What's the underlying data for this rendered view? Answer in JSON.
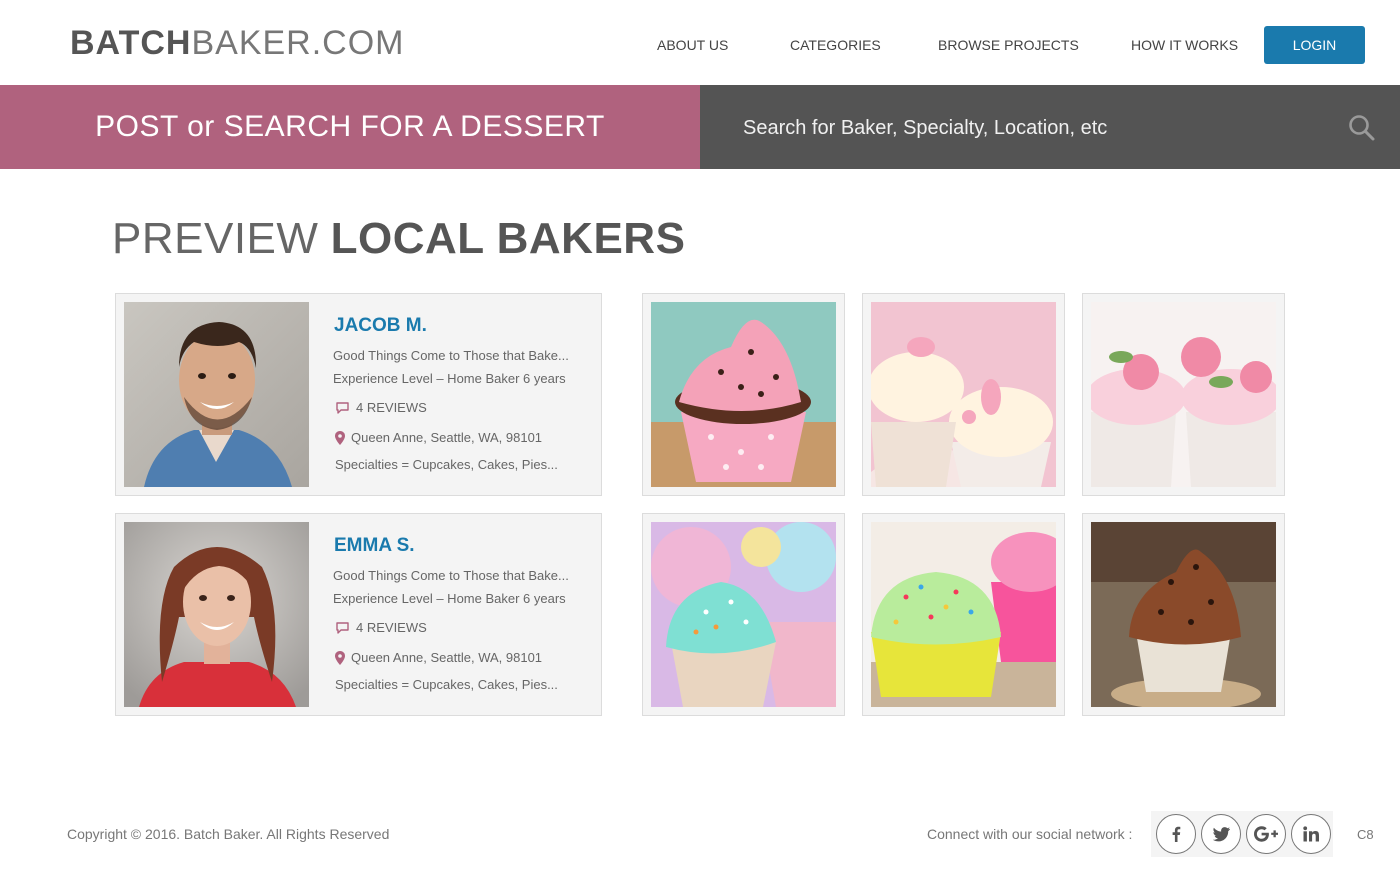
{
  "header": {
    "logo_bold": "BATCH",
    "logo_light": "BAKER.COM",
    "nav": [
      {
        "label": "ABOUT US"
      },
      {
        "label": "CATEGORIES"
      },
      {
        "label": "BROWSE PROJECTS"
      },
      {
        "label": "HOW IT WORKS"
      }
    ],
    "login_label": "LOGIN"
  },
  "banner": {
    "post_label": "POST or SEARCH FOR A DESSERT",
    "search_placeholder": "Search for Baker, Specialty, Location, etc",
    "search_icon": "search-icon"
  },
  "section": {
    "title_light": "PREVIEW",
    "title_bold": "LOCAL BAKERS"
  },
  "bakers": [
    {
      "name": "JACOB M.",
      "tagline": "Good Things Come to Those that Bake...",
      "experience": "Experience Level – Home Baker 6 years",
      "reviews": "4 REVIEWS",
      "location": "Queen Anne, Seattle, WA, 98101",
      "specialties": "Specialties = Cupcakes, Cakes, Pies..."
    },
    {
      "name": "EMMA S.",
      "tagline": "Good Things Come to Those that Bake...",
      "experience": "Experience Level – Home Baker 6 years",
      "reviews": "4 REVIEWS",
      "location": "Queen Anne, Seattle, WA, 98101",
      "specialties": "Specialties = Cupcakes, Cakes, Pies..."
    }
  ],
  "footer": {
    "copyright": "Copyright © 2016. Batch Baker. All Rights Reserved",
    "connect": "Connect with our social network :",
    "social": [
      "facebook-icon",
      "twitter-icon",
      "google-plus-icon",
      "linkedin-icon"
    ],
    "corner": "C8"
  },
  "colors": {
    "accent_blue": "#1a7aad",
    "banner_pink": "#b0627e",
    "banner_dark": "#545454"
  }
}
